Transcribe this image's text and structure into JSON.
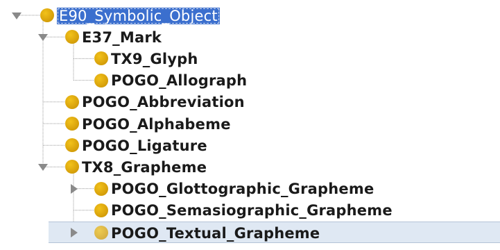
{
  "tree": {
    "nodes": [
      {
        "label": "E90_Symbolic_Object",
        "depth": 0,
        "state": "expanded",
        "selected": true
      },
      {
        "label": "E37_Mark",
        "depth": 1,
        "state": "expanded"
      },
      {
        "label": "TX9_Glyph",
        "depth": 2,
        "state": "leaf"
      },
      {
        "label": "POGO_Allograph",
        "depth": 2,
        "state": "leaf"
      },
      {
        "label": "POGO_Abbreviation",
        "depth": 1,
        "state": "leaf"
      },
      {
        "label": "POGO_Alphabeme",
        "depth": 1,
        "state": "leaf"
      },
      {
        "label": "POGO_Ligature",
        "depth": 1,
        "state": "leaf"
      },
      {
        "label": "TX8_Grapheme",
        "depth": 1,
        "state": "expanded"
      },
      {
        "label": "POGO_Glottographic_Grapheme",
        "depth": 2,
        "state": "collapsed"
      },
      {
        "label": "POGO_Semasiographic_Grapheme",
        "depth": 2,
        "state": "leaf"
      },
      {
        "label": "POGO_Textual_Grapheme",
        "depth": 2,
        "state": "collapsed",
        "hovered": true
      }
    ],
    "icon": "class-circle-icon",
    "colors": {
      "node_icon": "#e0aa0b",
      "selection_bg": "#3b6fce",
      "hover_bg": "#dfe8f3",
      "connector": "#9a9a9a"
    }
  }
}
